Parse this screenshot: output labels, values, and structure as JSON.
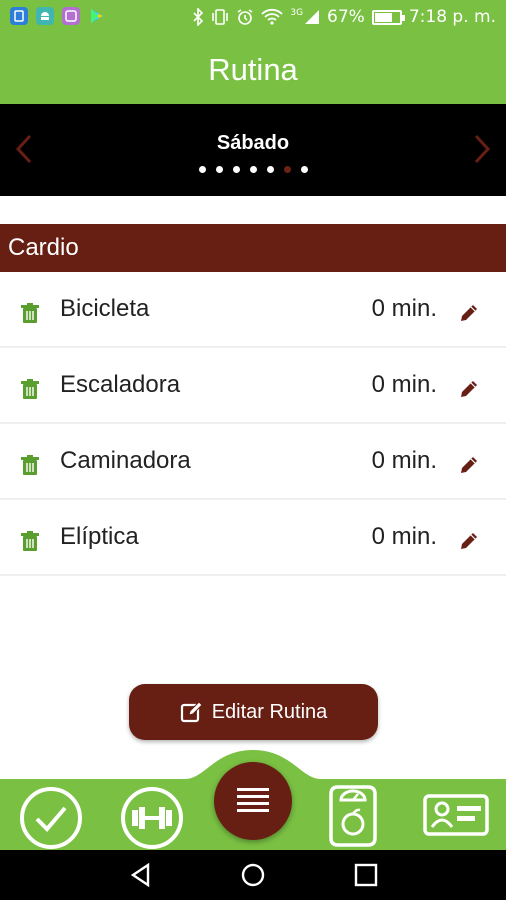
{
  "status_bar": {
    "battery": "67%",
    "battery_level": 0.67,
    "time": "7:18 p. m.",
    "network": "3G",
    "icons": [
      "app-icon-blue",
      "android-icon",
      "app-icon-purple",
      "play-store-icon",
      "bluetooth-icon",
      "vibrate-icon",
      "alarm-icon",
      "wifi-icon",
      "signal-icon",
      "battery-charging-icon"
    ]
  },
  "app_bar": {
    "title": "Rutina"
  },
  "day_selector": {
    "day": "Sábado",
    "page_count": 7,
    "active_index": 5
  },
  "section": {
    "title": "Cardio"
  },
  "exercises": [
    {
      "name": "Bicicleta",
      "duration": "0 min."
    },
    {
      "name": "Escaladora",
      "duration": "0 min."
    },
    {
      "name": "Caminadora",
      "duration": "0 min."
    },
    {
      "name": "Elíptica",
      "duration": "0 min."
    }
  ],
  "edit_button": {
    "label": "Editar Rutina"
  },
  "bottom_nav": {
    "items": [
      "check-icon",
      "dumbbell-icon",
      "menu-icon",
      "scale-icon",
      "profile-card-icon"
    ]
  },
  "colors": {
    "primary_green": "#7ac143",
    "dark_brown": "#661f12",
    "black": "#000000",
    "icon_green": "#5a9e2f"
  }
}
